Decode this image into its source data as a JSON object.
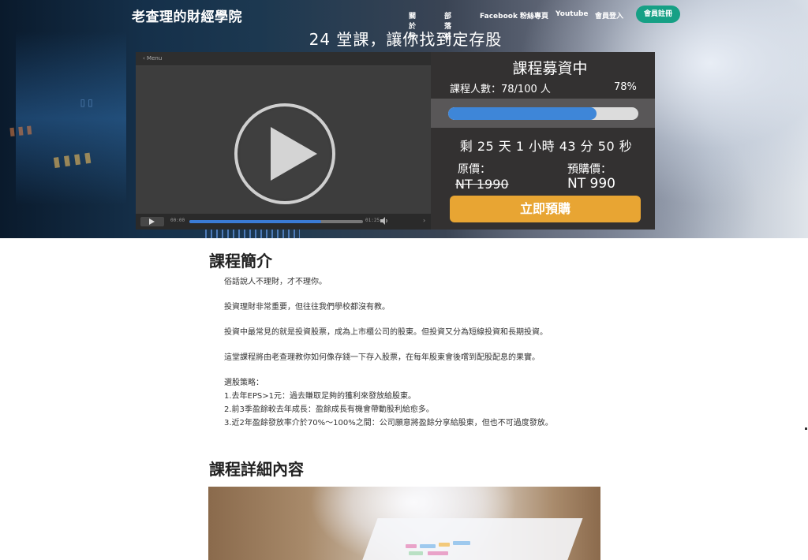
{
  "header": {
    "brand": "老查理的財經學院",
    "nav": [
      "關於我",
      "部落格",
      "Facebook 粉絲專頁",
      "Youtube",
      "會員登入"
    ],
    "signup": "會員註冊"
  },
  "hero": {
    "title": "24 堂課，讓你找到定存股"
  },
  "player": {
    "menu_label": "Menu",
    "time_current": "00:00",
    "time_total": "01:25",
    "progress_fraction": 0.76
  },
  "funding": {
    "title": "課程募資中",
    "count_text": "課程人數：78/100 人",
    "percent_text": "78%",
    "progress_fraction": 0.78,
    "countdown": "剩 25 天 1 小時 43 分 50 秒",
    "original_label": "原價：",
    "original_price": "NT 1990",
    "presale_label": "預購價：",
    "presale_price": "NT 990",
    "buy_button": "立即預購",
    "colors": {
      "bar": "#3e86d8",
      "button": "#e8a533",
      "signup": "#16a085"
    }
  },
  "intro": {
    "heading": "課程簡介",
    "p1": "俗話說人不理財，才不理你。",
    "p2": "投資理財非常重要，但往往我們學校都沒有教。",
    "p3": "投資中最常見的就是投資股票，成為上市櫃公司的股東。但投資又分為短線投資和長期投資。",
    "p4": "這堂課程將由老查理教你如何像存錢一下存入股票，在每年股東會後嚐到配股配息的果實。",
    "strategy_title": "選股策略：",
    "strategies": [
      "1.去年EPS>1元：過去賺取足夠的獲利來發放給股東。",
      "2.前3季盈餘較去年成長：盈餘成長有機會帶動股利給愈多。",
      "3.近2年盈餘發放率介於70%～100%之間：公司願意將盈餘分享給股東，但也不可過度發放。"
    ]
  },
  "details": {
    "heading": "課程詳細內容"
  }
}
